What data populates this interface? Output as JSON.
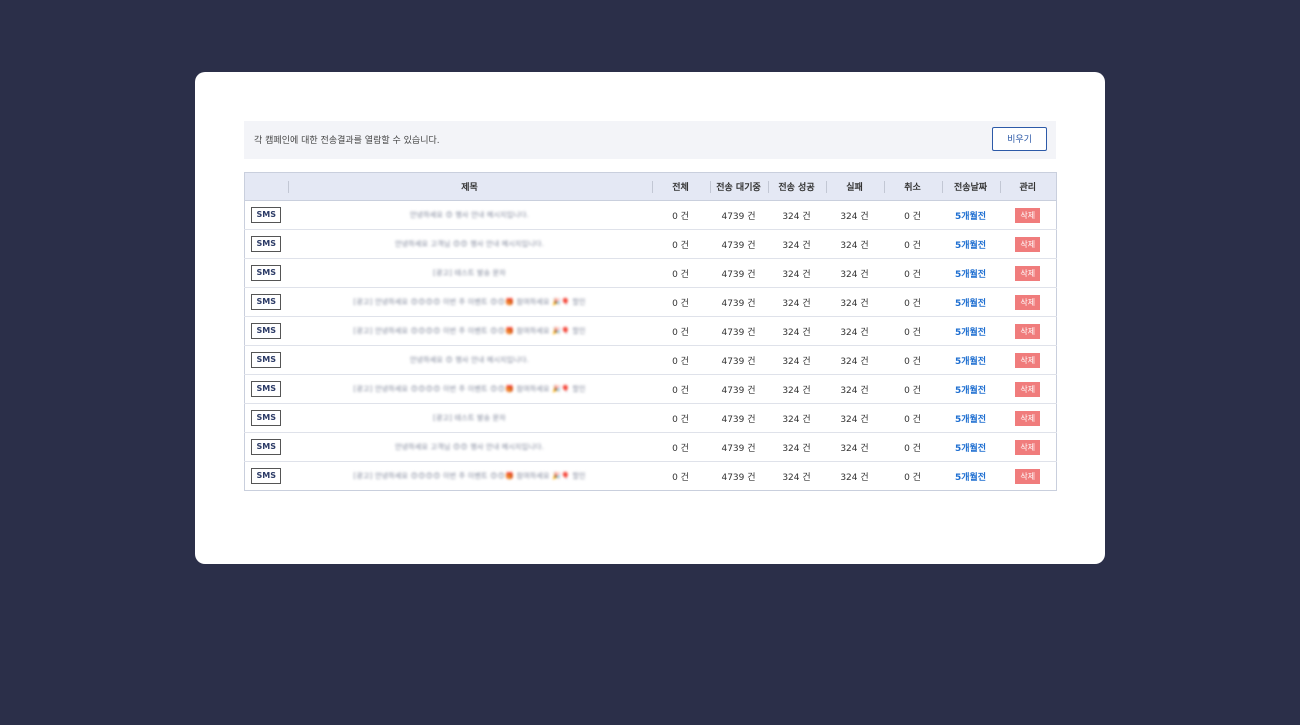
{
  "notice": {
    "text": "각 캠페인에 대한 전송결과를 열람할 수 있습니다.",
    "clear_label": "비우기"
  },
  "columns": [
    "",
    "제목",
    "전체",
    "전송 대기중",
    "전송 성공",
    "실패",
    "취소",
    "전송날짜",
    "관리"
  ],
  "rows": [
    {
      "type": "SMS",
      "title": "안녕하세요 😊 행사 안내 메시지입니다.",
      "total": "0 건",
      "pending": "4739 건",
      "success": "324 건",
      "fail": "324 건",
      "cancel": "0 건",
      "date": "5개월전",
      "action": "삭제"
    },
    {
      "type": "SMS",
      "title": "안녕하세요 고객님 😊😊 행사 안내 메시지입니다.",
      "total": "0 건",
      "pending": "4739 건",
      "success": "324 건",
      "fail": "324 건",
      "cancel": "0 건",
      "date": "5개월전",
      "action": "삭제"
    },
    {
      "type": "SMS",
      "title": "[광고] 테스트 발송 문자",
      "total": "0 건",
      "pending": "4739 건",
      "success": "324 건",
      "fail": "324 건",
      "cancel": "0 건",
      "date": "5개월전",
      "action": "삭제"
    },
    {
      "type": "SMS",
      "title": "[광고] 안녕하세요 😊😊😊😊 이번 주 이벤트 😊😊🎁 참여하세요 🎉🎈 할인",
      "total": "0 건",
      "pending": "4739 건",
      "success": "324 건",
      "fail": "324 건",
      "cancel": "0 건",
      "date": "5개월전",
      "action": "삭제"
    },
    {
      "type": "SMS",
      "title": "[광고] 안녕하세요 😊😊😊😊 이번 주 이벤트 😊😊🎁 참여하세요 🎉🎈 할인",
      "total": "0 건",
      "pending": "4739 건",
      "success": "324 건",
      "fail": "324 건",
      "cancel": "0 건",
      "date": "5개월전",
      "action": "삭제"
    },
    {
      "type": "SMS",
      "title": "안녕하세요 😊 행사 안내 메시지입니다.",
      "total": "0 건",
      "pending": "4739 건",
      "success": "324 건",
      "fail": "324 건",
      "cancel": "0 건",
      "date": "5개월전",
      "action": "삭제"
    },
    {
      "type": "SMS",
      "title": "[광고] 안녕하세요 😊😊😊😊 이번 주 이벤트 😊😊🎁 참여하세요 🎉🎈 할인",
      "total": "0 건",
      "pending": "4739 건",
      "success": "324 건",
      "fail": "324 건",
      "cancel": "0 건",
      "date": "5개월전",
      "action": "삭제"
    },
    {
      "type": "SMS",
      "title": "[광고] 테스트 발송 문자",
      "total": "0 건",
      "pending": "4739 건",
      "success": "324 건",
      "fail": "324 건",
      "cancel": "0 건",
      "date": "5개월전",
      "action": "삭제"
    },
    {
      "type": "SMS",
      "title": "안녕하세요 고객님 😊😊 행사 안내 메시지입니다.",
      "total": "0 건",
      "pending": "4739 건",
      "success": "324 건",
      "fail": "324 건",
      "cancel": "0 건",
      "date": "5개월전",
      "action": "삭제"
    },
    {
      "type": "SMS",
      "title": "[광고] 안녕하세요 😊😊😊😊 이번 주 이벤트 😊😊🎁 참여하세요 🎉🎈 할인",
      "total": "0 건",
      "pending": "4739 건",
      "success": "324 건",
      "fail": "324 건",
      "cancel": "0 건",
      "date": "5개월전",
      "action": "삭제"
    }
  ],
  "colors": {
    "background": "#2b2f49",
    "header_bg": "#e4e8f4",
    "link": "#1f6fd1",
    "delete": "#f07c7c",
    "button_border": "#2d5aa8"
  }
}
